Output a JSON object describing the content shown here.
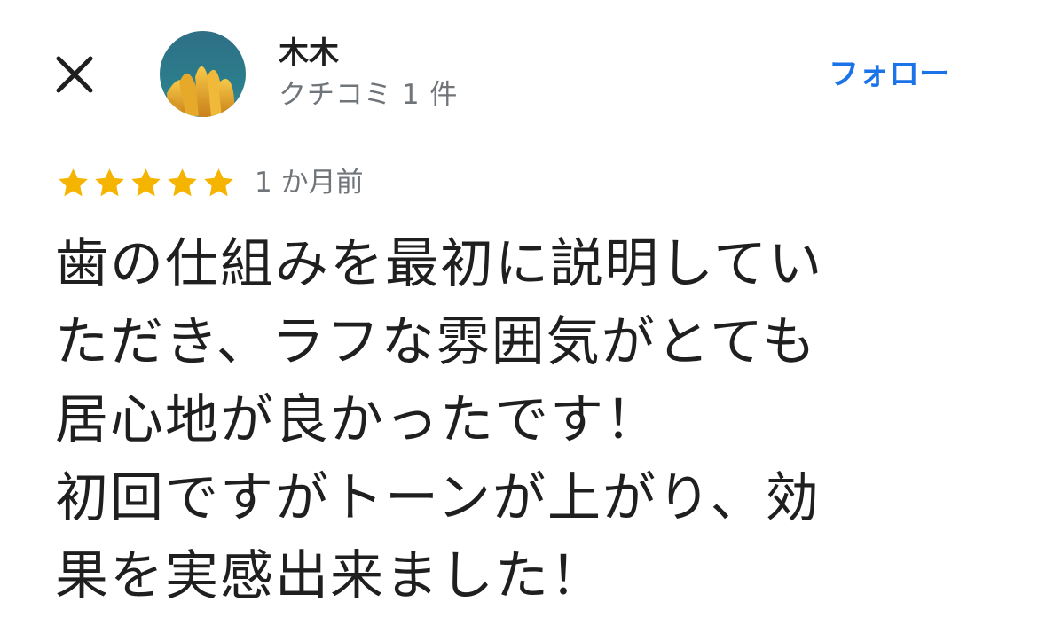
{
  "header": {
    "close_icon": "close-icon",
    "user_name": "木木",
    "review_count": "クチコミ 1 件",
    "follow_label": "フォロー"
  },
  "rating": {
    "stars": 5,
    "max_stars": 5,
    "time_ago": "1 か月前"
  },
  "review": {
    "lines": [
      "歯の仕組みを最初に説明してい",
      "ただき、ラフな雰囲気がとても",
      "居心地が良かったです！",
      "初回ですがトーンが上がり、効",
      "果を実感出来ました！"
    ]
  },
  "colors": {
    "accent": "#1a73e8",
    "star": "#f4b400",
    "secondary_text": "#70757a",
    "primary_text": "#1f1f1f"
  }
}
